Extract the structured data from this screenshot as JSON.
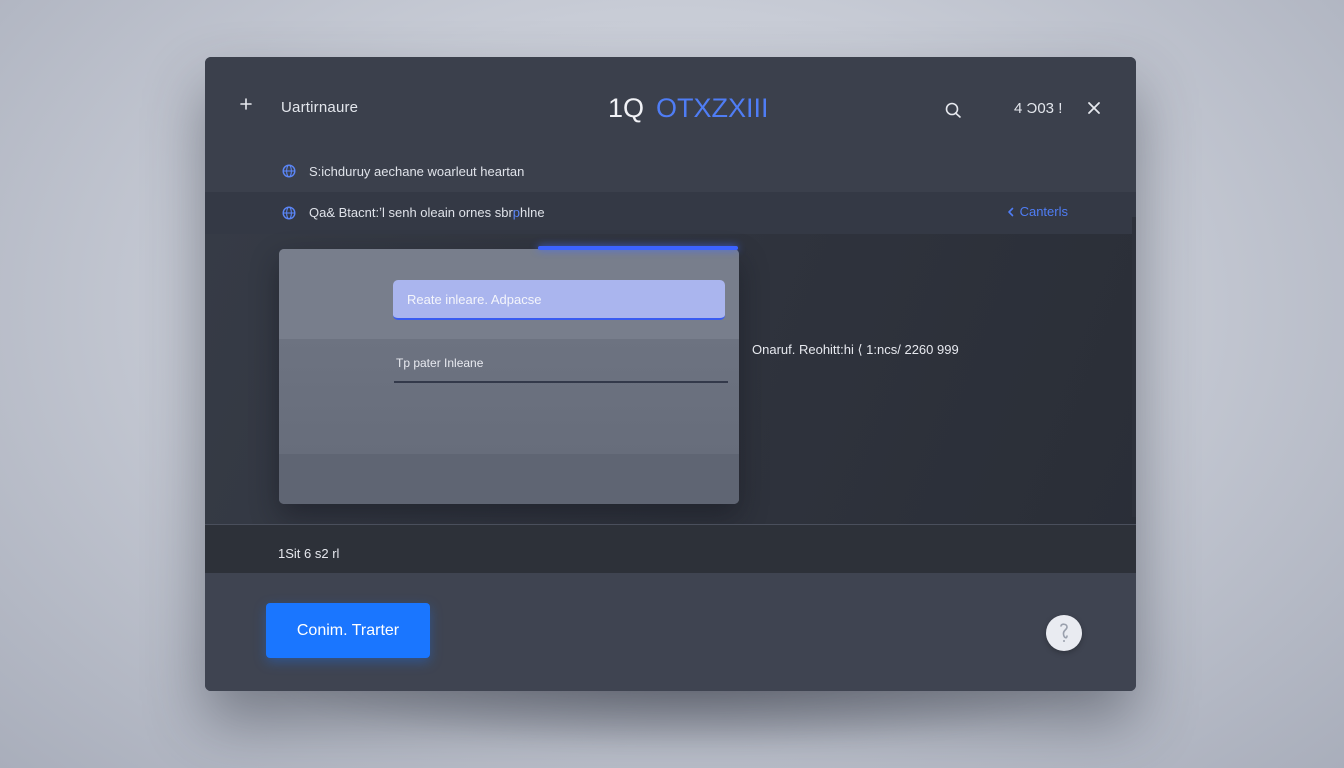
{
  "titlebar": {
    "app_name": "Uartirnaure",
    "title_part1": "1Q",
    "title_part2": "OTXZXIII",
    "status_text": "4 Ɔ03 !"
  },
  "info_rows": [
    {
      "text": "S:ichduruy aechane woarleut heartan"
    },
    {
      "text": "Qa& Btacnt:ʼl senh  oleain ornes sbr",
      "accent": "p",
      "text_end": "hlne",
      "link": "Canterls"
    }
  ],
  "form": {
    "address_placeholder": "Reate inleare. Adpacse",
    "second_label": "Tp pater Inleane"
  },
  "side_info": "Onaruf. Reohitt:hi  ⟨  1:ncs/ 2260 999",
  "footer_text": "1Sit 6 s2 rl",
  "actions": {
    "primary_label": "Conim. Trarter"
  },
  "colors": {
    "accent": "#4f7df5",
    "button": "#1a76ff",
    "window": "#3a3f4b",
    "input_fill": "#aab5ee"
  },
  "icons": {
    "add": "plus-icon",
    "search": "search-icon",
    "close": "close-icon",
    "globe": "globe-icon",
    "chevron": "chevron-left-icon",
    "help": "help-icon"
  }
}
